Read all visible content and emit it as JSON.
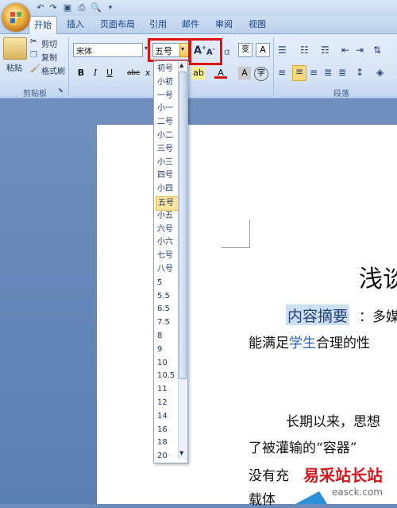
{
  "tabs": [
    "开始",
    "插入",
    "页面布局",
    "引用",
    "邮件",
    "审阅",
    "视图"
  ],
  "clipboard": {
    "paste_label": "粘贴",
    "cut_label": "剪切",
    "copy_label": "复制",
    "format_painter_label": "格式刷",
    "group_label": "剪贴板"
  },
  "font": {
    "name": "宋体",
    "size": "五号"
  },
  "paragraph": {
    "group_label": "段落"
  },
  "font_size_options": [
    "初号",
    "小初",
    "一号",
    "小一",
    "二号",
    "小二",
    "三号",
    "小三",
    "四号",
    "小四",
    "五号",
    "小五",
    "六号",
    "小六",
    "七号",
    "八号",
    "5",
    "5.5",
    "6.5",
    "7.5",
    "8",
    "9",
    "10",
    "10.5",
    "11",
    "12",
    "14",
    "16",
    "18",
    "20"
  ],
  "selected_font_size": "五号",
  "document": {
    "title": "浅谈",
    "abstract_label": "内容摘要",
    "line1_rest": "：多媒",
    "line2_pre": "能满足",
    "line2_link": "学生",
    "line2_post": "合理的性",
    "line3": "长期以来，思想",
    "line4": "了被灌输的“容器”",
    "line5": "没有充",
    "line6": "载体"
  },
  "watermark": {
    "text": "易采站长站",
    "url": "easck.com"
  },
  "colors": {
    "highlight_red": "#e01313",
    "ribbon_blue": "#15428b",
    "selected_item": "#fde49a"
  }
}
